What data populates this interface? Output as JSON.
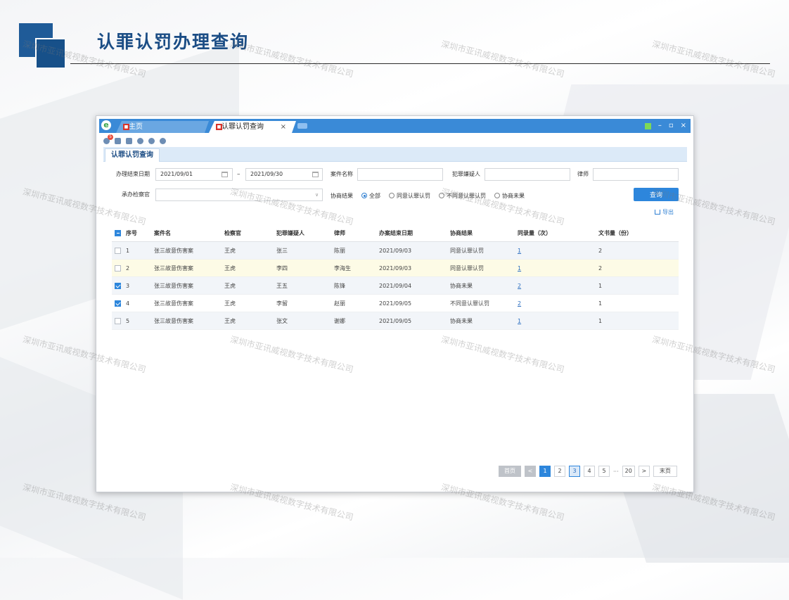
{
  "page": {
    "title": "认罪认罚办理查询"
  },
  "watermark": "深圳市亚讯威视数字技术有限公司",
  "window": {
    "tabs": [
      {
        "label": "主页"
      },
      {
        "label": "认罪认罚查询"
      }
    ],
    "tab_close": "×",
    "window_controls": [
      "–",
      "▫",
      "×"
    ],
    "toolbar_badge": "5"
  },
  "subtab": {
    "label": "认罪认罚查询"
  },
  "filters": {
    "end_date_label": "办理结束日期",
    "date_from": "2021/09/01",
    "date_separator": "–",
    "date_to": "2021/09/30",
    "case_name_label": "案件名称",
    "case_name_value": "",
    "suspect_label": "犯罪嫌疑人",
    "suspect_value": "",
    "lawyer_label": "律师",
    "lawyer_value": "",
    "prosecutor_label": "承办检察官",
    "prosecutor_value": "",
    "result_label": "协商结果",
    "result_options": [
      {
        "label": "全部",
        "selected": true
      },
      {
        "label": "同意认罪认罚",
        "selected": false
      },
      {
        "label": "不同意认罪认罚",
        "selected": false
      },
      {
        "label": "协商未果",
        "selected": false
      }
    ],
    "query_button": "查询",
    "export_label": "导出"
  },
  "table": {
    "columns": [
      "序号",
      "案件名",
      "检察官",
      "犯罪嫌疑人",
      "律师",
      "办案结束日期",
      "协商结果",
      "同录量（次）",
      "文书量（份）"
    ],
    "rows": [
      {
        "checked": false,
        "no": "1",
        "case": "张三故意伤害案",
        "prosecutor": "王虎",
        "suspect": "张三",
        "lawyer": "陈丽",
        "date": "2021/09/03",
        "result": "同意认罪认罚",
        "records": "1",
        "docs": "2"
      },
      {
        "checked": false,
        "no": "2",
        "case": "张三故意伤害案",
        "prosecutor": "王虎",
        "suspect": "李四",
        "lawyer": "李海生",
        "date": "2021/09/03",
        "result": "同意认罪认罚",
        "records": "1",
        "docs": "2"
      },
      {
        "checked": true,
        "no": "3",
        "case": "张三故意伤害案",
        "prosecutor": "王虎",
        "suspect": "王五",
        "lawyer": "陈锋",
        "date": "2021/09/04",
        "result": "协商未果",
        "records": "2",
        "docs": "1"
      },
      {
        "checked": true,
        "no": "4",
        "case": "张三故意伤害案",
        "prosecutor": "王虎",
        "suspect": "李留",
        "lawyer": "赵丽",
        "date": "2021/09/05",
        "result": "不同意认罪认罚",
        "records": "2",
        "docs": "1"
      },
      {
        "checked": false,
        "no": "5",
        "case": "张三故意伤害案",
        "prosecutor": "王虎",
        "suspect": "张文",
        "lawyer": "谢娜",
        "date": "2021/09/05",
        "result": "协商未果",
        "records": "1",
        "docs": "1"
      }
    ]
  },
  "pagination": {
    "first": "首页",
    "prev": "<",
    "pages": [
      "1",
      "2",
      "3",
      "4",
      "5"
    ],
    "current": "1",
    "highlighted": "3",
    "dots": "···",
    "last_page": "20",
    "next": ">",
    "last": "末页"
  },
  "colors": {
    "brand": "#1f5b98",
    "accent": "#2d86dc",
    "tabbar": "#3a8ad7"
  }
}
